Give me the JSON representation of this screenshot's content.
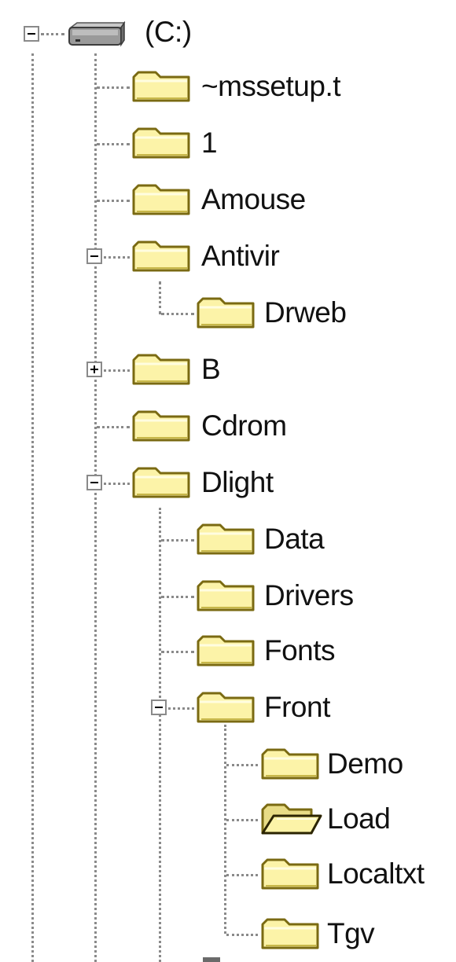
{
  "tree": {
    "root": {
      "label": "(C:)",
      "icon": "drive-icon",
      "expanded": true
    },
    "items": [
      {
        "label": "~mssetup.t",
        "icon": "folder-icon"
      },
      {
        "label": "1",
        "icon": "folder-icon"
      },
      {
        "label": "Amouse",
        "icon": "folder-icon"
      },
      {
        "label": "Antivir",
        "icon": "folder-icon",
        "expanded": true
      },
      {
        "label": "Drweb",
        "icon": "folder-icon"
      },
      {
        "label": "B",
        "icon": "folder-icon",
        "expanded": false
      },
      {
        "label": "Cdrom",
        "icon": "folder-icon"
      },
      {
        "label": "Dlight",
        "icon": "folder-icon",
        "expanded": true
      },
      {
        "label": "Data",
        "icon": "folder-icon"
      },
      {
        "label": "Drivers",
        "icon": "folder-icon"
      },
      {
        "label": "Fonts",
        "icon": "folder-icon"
      },
      {
        "label": "Front",
        "icon": "folder-icon",
        "expanded": true
      },
      {
        "label": "Demo",
        "icon": "folder-icon"
      },
      {
        "label": "Load",
        "icon": "folder-open-icon"
      },
      {
        "label": "Localtxt",
        "icon": "folder-icon"
      },
      {
        "label": "Tgv",
        "icon": "folder-icon"
      }
    ]
  },
  "colors": {
    "folder_fill": "#fcf3a8",
    "folder_outline": "#7a6a12",
    "connector": "#8a8a8a",
    "text": "#111111"
  }
}
